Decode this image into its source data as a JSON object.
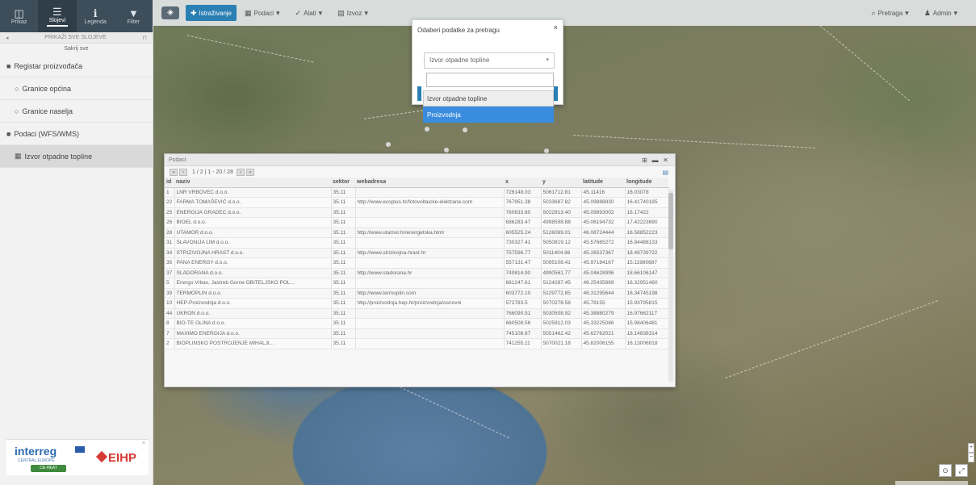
{
  "sidebar": {
    "tabs": [
      {
        "label": "Prikaz",
        "icon": "layers-grid-icon",
        "active": false
      },
      {
        "label": "Slojevi",
        "icon": "list-icon",
        "active": true
      },
      {
        "label": "Legenda",
        "icon": "info-icon",
        "active": false
      },
      {
        "label": "Filter",
        "icon": "funnel-icon",
        "active": false
      }
    ],
    "header_text": "PRIKAŽI SVE SLOJEVE",
    "sub_text": "Sakrij sve",
    "tree": [
      {
        "label": "Registar proizvođača",
        "icon": "folder-icon",
        "indent": false,
        "selected": false
      },
      {
        "label": "Granice općina",
        "icon": "radio-icon",
        "indent": true,
        "selected": false
      },
      {
        "label": "Granice naselja",
        "icon": "radio-icon",
        "indent": true,
        "selected": false
      },
      {
        "label": "Podaci (WFS/WMS)",
        "icon": "folder-icon",
        "indent": false,
        "selected": false
      },
      {
        "label": "Izvor otpadne topline",
        "icon": "table-icon",
        "indent": true,
        "selected": true
      }
    ],
    "logos": {
      "interreg": "interreg",
      "interreg_sub": "CENTRAL EUROPE",
      "badge": "CE-HEAT",
      "eihp": "EIHP"
    }
  },
  "toolbar": {
    "primary_button": "Istraživanje",
    "buttons": [
      "Podaci",
      "Alati",
      "Izvoz"
    ],
    "right_buttons": [
      "Pretraga",
      "Admin"
    ]
  },
  "dialog": {
    "title": "Odaberi podatke za pretragu",
    "select_value": "Izvor otpadne topline",
    "options": [
      {
        "label": "Izvor otpadne topline",
        "highlighted": false
      },
      {
        "label": "Proizvodnja",
        "highlighted": true
      }
    ]
  },
  "panel": {
    "title": "Podaci",
    "pager_text": "1 / 2 | 1 - 20 / 28",
    "columns": [
      "id",
      "naziv",
      "sektor",
      "webadresa",
      "x",
      "y",
      "latitude",
      "longitude"
    ],
    "rows": [
      [
        "1",
        "LNR VRBOVEC d.o.o.",
        "35.11",
        "",
        "726148.03",
        "5061712.81",
        "45.11416",
        "16.03078"
      ],
      [
        "22",
        "FARMA TOMAŠEVIĆ d.o.o.",
        "35.11",
        "http://www.ecoplus.hr/fotovoltaicke-elektrane.com",
        "767951.38",
        "5033687.82",
        "45.09888830",
        "16.41740185"
      ],
      [
        "25",
        "ENERGIJA GRADEC d.o.o.",
        "35.11",
        "",
        "760633.80",
        "5022913.40",
        "45.09893002",
        "16.17422"
      ],
      [
        "26",
        "BIOEL d.o.o.",
        "35.11",
        "",
        "686283.47",
        "4998598.88",
        "45.06194732",
        "17.42223690"
      ],
      [
        "28",
        "UTAMOR d.o.o.",
        "35.11",
        "http://www.utamor.hr/energetska.html",
        "605525.24",
        "5126069.01",
        "46.08724444",
        "16.58852223"
      ],
      [
        "31",
        "SLAVONIJA LIM d.o.o.",
        "35.11",
        "",
        "730327.41",
        "5050819.12",
        "45.57665272",
        "16.84488133"
      ],
      [
        "34",
        "STRIZIVOJNA HRAST d.o.o.",
        "35.11",
        "http://www.strizivojna-hrast.hr",
        "757596.77",
        "5011404.86",
        "45.26537367",
        "18.48739722"
      ],
      [
        "35",
        "PANA ENERGY d.o.o.",
        "35.11",
        "",
        "557131.47",
        "5095108.41",
        "45.97184167",
        "15.11980687"
      ],
      [
        "37",
        "SLADORANA d.o.o.",
        "35.11",
        "http://www.sladorana.hr",
        "740814.90",
        "4990561.77",
        "45.04628996",
        "18.66106147"
      ],
      [
        "5",
        "Energo Vrbas, Jastreb Gorne OBITELJSKO POL...",
        "35.11",
        "",
        "661247.61",
        "5124287.45",
        "46.25435869",
        "16.32951460"
      ],
      [
        "39",
        "TERMOPLIN d.o.o.",
        "35.11",
        "http://www.termoplin.com",
        "603772.10",
        "5129772.85",
        "46.31295644",
        "16.34745198"
      ],
      [
        "10",
        "HEP-Proizvodnja d.o.o.",
        "35.11",
        "http://proizvodnja.hep.hr/proizvodnja/osnovni",
        "572783.5",
        "5070278.58",
        "45.78155",
        "15.93795815"
      ],
      [
        "44",
        "UKRON d.o.o.",
        "35.11",
        "",
        "766090.51",
        "5030508.92",
        "45.38880279",
        "16.97662117"
      ],
      [
        "8",
        "BIO-TE GLINA d.o.o.",
        "35.11",
        "",
        "660508.56",
        "5025912.03",
        "45.33225086",
        "15.98406481"
      ],
      [
        "7",
        "MAXIMO ENERGIJA d.o.o.",
        "35.11",
        "",
        "745108.87",
        "5051462.42",
        "45.62762021",
        "18.14838314"
      ],
      [
        "2",
        "BIOPLINSKO POSTROJENJE MIHALJI...",
        "35.11",
        "",
        "741255.11",
        "5070021.18",
        "45.82006155",
        "16.13006818"
      ]
    ]
  },
  "colors": {
    "sidebar_tabs_bg": "#3d4e5a",
    "primary": "#2a7fb3",
    "highlight": "#3a8dde",
    "eihp_red": "#d63a33",
    "interreg_blue": "#2a6bb0"
  }
}
